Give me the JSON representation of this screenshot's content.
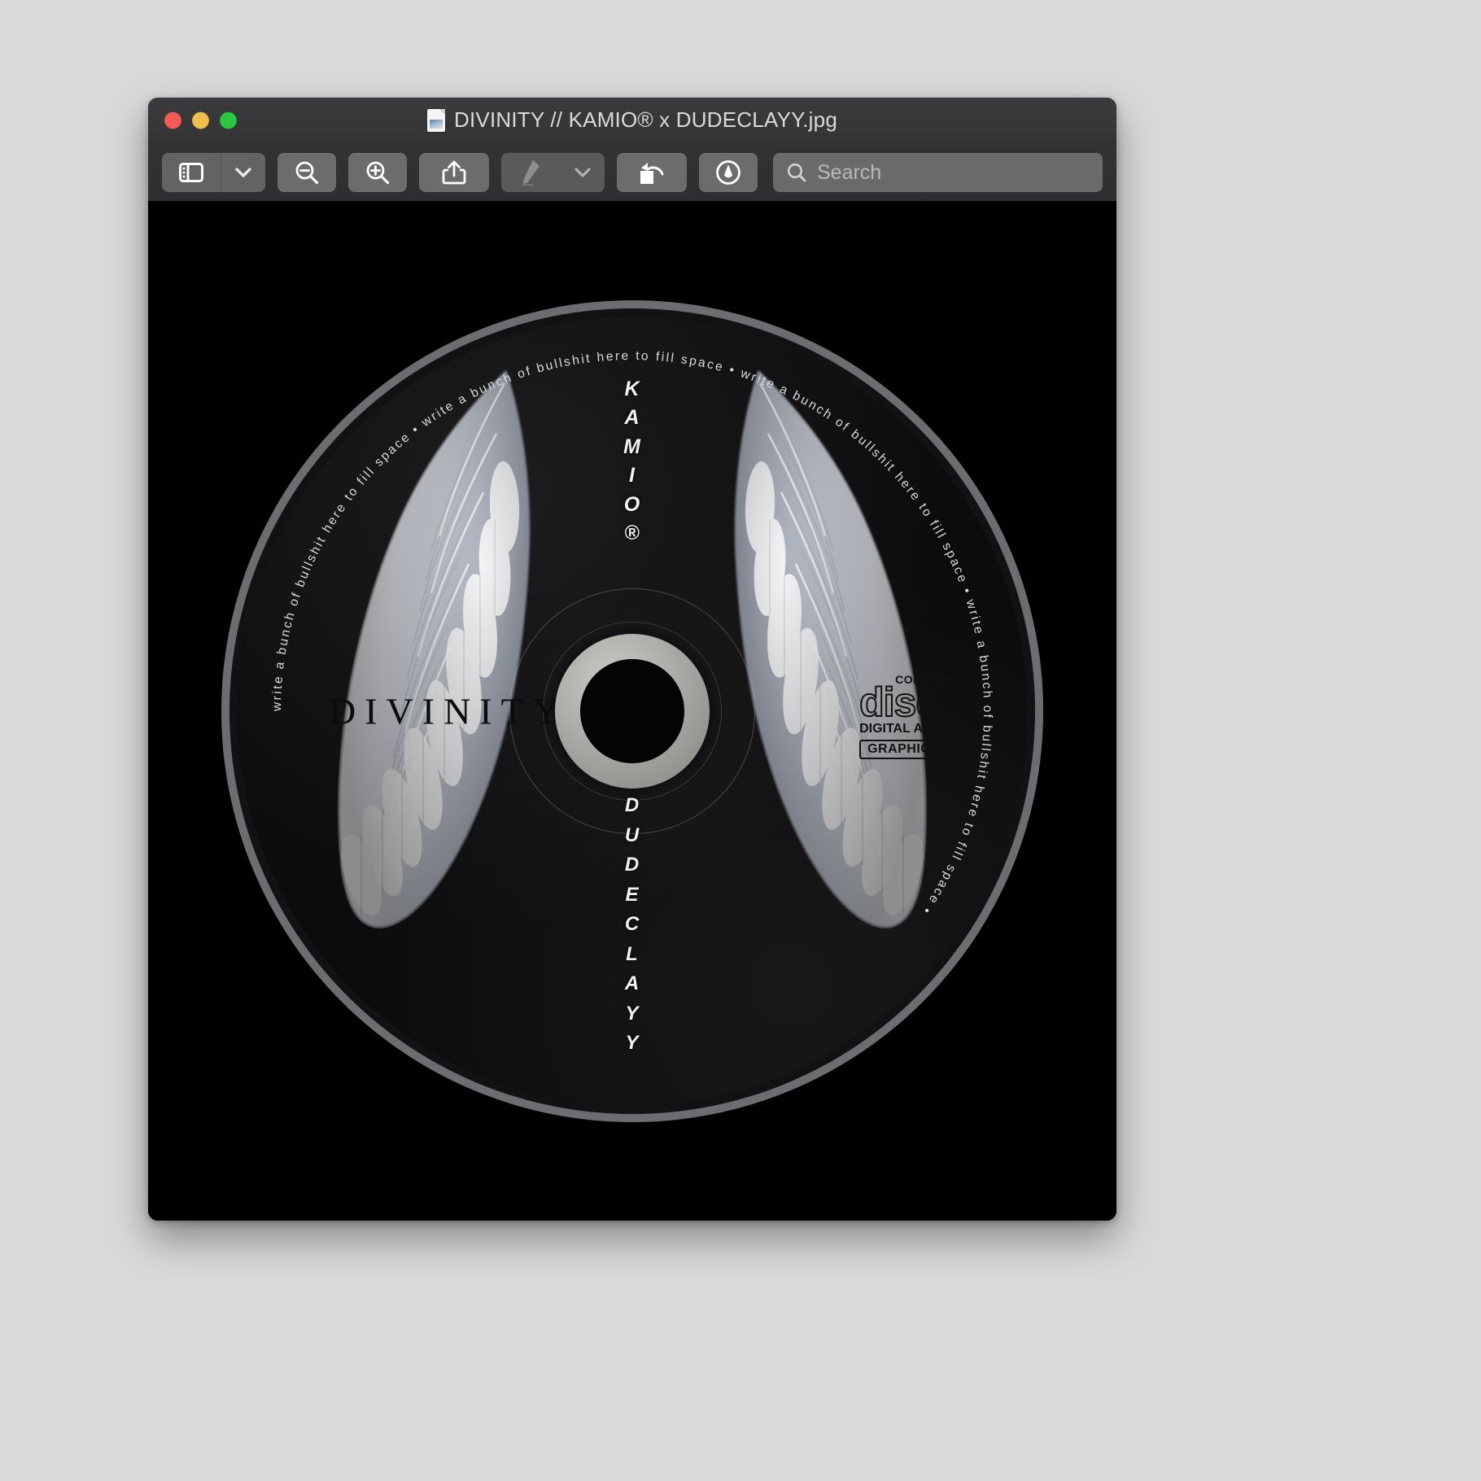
{
  "window": {
    "title": "DIVINITY // KAMIO® x DUDECLAYY.jpg",
    "traffic_lights": [
      {
        "name": "close",
        "color": "#f35b57"
      },
      {
        "name": "minimize",
        "color": "#f0be4f"
      },
      {
        "name": "zoom",
        "color": "#2bc73f"
      }
    ]
  },
  "toolbar": {
    "sidebar_button": "sidebar-view",
    "sidebar_chevron": "chevron-down",
    "zoom_out_button": "zoom-out",
    "zoom_in_button": "zoom-in",
    "share_button": "share",
    "markup_button": "markup-pen",
    "markup_chevron": "chevron-down",
    "rotate_button": "rotate-left",
    "annotate_button": "annotate",
    "search": {
      "placeholder": "Search",
      "value": ""
    }
  },
  "artwork": {
    "disc_title": "DIVINITY",
    "label_top": "KAMIO®",
    "label_top_letters": [
      "K",
      "A",
      "M",
      "I",
      "O",
      "®"
    ],
    "label_bottom": "DUDECLAYY",
    "label_bottom_letters": [
      "D",
      "U",
      "D",
      "E",
      "C",
      "L",
      "A",
      "Y",
      "Y"
    ],
    "rim_text": "write a bunch of bullshit here to fill space  •  ",
    "rim_text_repeats": 4,
    "cd_logo": {
      "line1": "COMPACT",
      "line2": "disc",
      "line3": "DIGITAL AUDIO",
      "line4": "GRAPHICS"
    },
    "colors": {
      "background": "#000000",
      "disc_face": "#0c0c0e",
      "disc_rim": "#6b6d71",
      "hub": "#b5b5b0",
      "title_text": "#0b0b0d",
      "label_text": "#f2f2f2"
    }
  }
}
